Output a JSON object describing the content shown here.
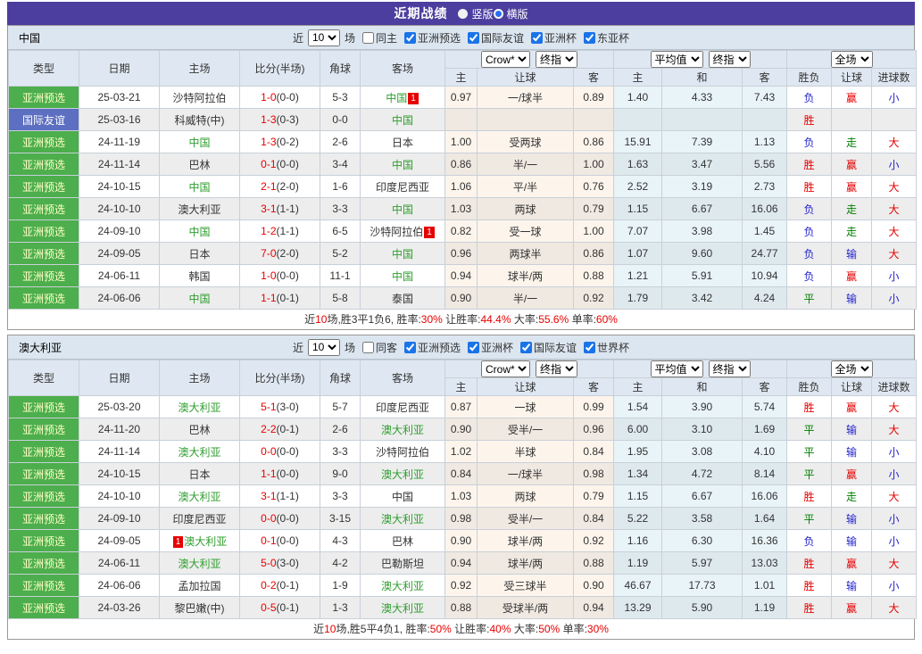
{
  "colors": {
    "titlebar_purple": "#4c3e9e",
    "section_bar_bg": "#dce6f0",
    "header_bg": "#dfe8f2",
    "type_green": "#4cae4c",
    "type_blue": "#5c6fc0",
    "focus_team_green": "#2f9e2f",
    "result_red": "#e60000",
    "result_blue": "#2424cc",
    "result_green": "#008000",
    "crow_col_bg": "#fdf5ec",
    "avg_col_bg": "#e9f4f9"
  },
  "titlebar": {
    "title": "近期战绩",
    "layout_options": [
      {
        "label": "竖版",
        "selected": false
      },
      {
        "label": "横版",
        "selected": true
      }
    ]
  },
  "columns": {
    "type": "类型",
    "date": "日期",
    "home": "主场",
    "score": "比分(半场)",
    "corner": "角球",
    "away": "客场",
    "odds_home": "主",
    "odds_handicap": "让球",
    "odds_away": "客",
    "avg_home": "主",
    "avg_draw": "和",
    "avg_away": "客",
    "result_wl": "胜负",
    "result_handicap": "让球",
    "result_goals": "进球数"
  },
  "dropdowns": {
    "odds_source": "Crow*",
    "odds_index": "终指",
    "avg_source": "平均值",
    "avg_index": "终指",
    "scope": "全场"
  },
  "sections": [
    {
      "team": "中国",
      "filter": {
        "prefix": "近",
        "count": "10",
        "suffix": "场",
        "same_side": "同主",
        "same_checked": false,
        "leagues": [
          "亚洲预选",
          "国际友谊",
          "亚洲杯",
          "东亚杯"
        ]
      },
      "rows": [
        {
          "type": "亚洲预选",
          "typeStyle": "green",
          "date": "25-03-21",
          "home": "沙特阿拉伯",
          "homeFocus": false,
          "score": "1-0",
          "half": "(0-0)",
          "corner": "5-3",
          "away": "中国",
          "awayFocus": true,
          "awayBadge": "1",
          "odds": [
            "0.97",
            "一/球半",
            "0.89"
          ],
          "avg": [
            "1.40",
            "4.33",
            "7.43"
          ],
          "results": [
            {
              "t": "负",
              "c": "blue"
            },
            {
              "t": "赢",
              "c": "red"
            },
            {
              "t": "小",
              "c": "blue"
            }
          ]
        },
        {
          "type": "国际友谊",
          "typeStyle": "blue",
          "date": "25-03-16",
          "home": "科威特(中)",
          "homeFocus": false,
          "score": "1-3",
          "half": "(0-3)",
          "corner": "0-0",
          "away": "中国",
          "awayFocus": true,
          "odds": [
            "",
            "",
            ""
          ],
          "avg": [
            "",
            "",
            ""
          ],
          "results": [
            {
              "t": "胜",
              "c": "red"
            },
            {
              "t": "",
              "c": ""
            },
            {
              "t": "",
              "c": ""
            }
          ]
        },
        {
          "type": "亚洲预选",
          "typeStyle": "green",
          "date": "24-11-19",
          "home": "中国",
          "homeFocus": true,
          "score": "1-3",
          "half": "(0-2)",
          "corner": "2-6",
          "away": "日本",
          "awayFocus": false,
          "odds": [
            "1.00",
            "受两球",
            "0.86"
          ],
          "avg": [
            "15.91",
            "7.39",
            "1.13"
          ],
          "results": [
            {
              "t": "负",
              "c": "blue"
            },
            {
              "t": "走",
              "c": "green"
            },
            {
              "t": "大",
              "c": "red"
            }
          ]
        },
        {
          "type": "亚洲预选",
          "typeStyle": "green",
          "date": "24-11-14",
          "home": "巴林",
          "homeFocus": false,
          "score": "0-1",
          "half": "(0-0)",
          "corner": "3-4",
          "away": "中国",
          "awayFocus": true,
          "odds": [
            "0.86",
            "半/一",
            "1.00"
          ],
          "avg": [
            "1.63",
            "3.47",
            "5.56"
          ],
          "results": [
            {
              "t": "胜",
              "c": "red"
            },
            {
              "t": "赢",
              "c": "red"
            },
            {
              "t": "小",
              "c": "blue"
            }
          ]
        },
        {
          "type": "亚洲预选",
          "typeStyle": "green",
          "date": "24-10-15",
          "home": "中国",
          "homeFocus": true,
          "score": "2-1",
          "half": "(2-0)",
          "corner": "1-6",
          "away": "印度尼西亚",
          "awayFocus": false,
          "odds": [
            "1.06",
            "平/半",
            "0.76"
          ],
          "avg": [
            "2.52",
            "3.19",
            "2.73"
          ],
          "results": [
            {
              "t": "胜",
              "c": "red"
            },
            {
              "t": "赢",
              "c": "red"
            },
            {
              "t": "大",
              "c": "red"
            }
          ]
        },
        {
          "type": "亚洲预选",
          "typeStyle": "green",
          "date": "24-10-10",
          "home": "澳大利亚",
          "homeFocus": false,
          "score": "3-1",
          "half": "(1-1)",
          "corner": "3-3",
          "away": "中国",
          "awayFocus": true,
          "odds": [
            "1.03",
            "两球",
            "0.79"
          ],
          "avg": [
            "1.15",
            "6.67",
            "16.06"
          ],
          "results": [
            {
              "t": "负",
              "c": "blue"
            },
            {
              "t": "走",
              "c": "green"
            },
            {
              "t": "大",
              "c": "red"
            }
          ]
        },
        {
          "type": "亚洲预选",
          "typeStyle": "green",
          "date": "24-09-10",
          "home": "中国",
          "homeFocus": true,
          "score": "1-2",
          "half": "(1-1)",
          "corner": "6-5",
          "away": "沙特阿拉伯",
          "awayFocus": false,
          "awayBadge": "1",
          "odds": [
            "0.82",
            "受一球",
            "1.00"
          ],
          "avg": [
            "7.07",
            "3.98",
            "1.45"
          ],
          "results": [
            {
              "t": "负",
              "c": "blue"
            },
            {
              "t": "走",
              "c": "green"
            },
            {
              "t": "大",
              "c": "red"
            }
          ]
        },
        {
          "type": "亚洲预选",
          "typeStyle": "green",
          "date": "24-09-05",
          "home": "日本",
          "homeFocus": false,
          "score": "7-0",
          "half": "(2-0)",
          "corner": "5-2",
          "away": "中国",
          "awayFocus": true,
          "odds": [
            "0.96",
            "两球半",
            "0.86"
          ],
          "avg": [
            "1.07",
            "9.60",
            "24.77"
          ],
          "results": [
            {
              "t": "负",
              "c": "blue"
            },
            {
              "t": "输",
              "c": "blue"
            },
            {
              "t": "大",
              "c": "red"
            }
          ]
        },
        {
          "type": "亚洲预选",
          "typeStyle": "green",
          "date": "24-06-11",
          "home": "韩国",
          "homeFocus": false,
          "score": "1-0",
          "half": "(0-0)",
          "corner": "11-1",
          "away": "中国",
          "awayFocus": true,
          "odds": [
            "0.94",
            "球半/两",
            "0.88"
          ],
          "avg": [
            "1.21",
            "5.91",
            "10.94"
          ],
          "results": [
            {
              "t": "负",
              "c": "blue"
            },
            {
              "t": "赢",
              "c": "red"
            },
            {
              "t": "小",
              "c": "blue"
            }
          ]
        },
        {
          "type": "亚洲预选",
          "typeStyle": "green",
          "date": "24-06-06",
          "home": "中国",
          "homeFocus": true,
          "score": "1-1",
          "half": "(0-1)",
          "corner": "5-8",
          "away": "泰国",
          "awayFocus": false,
          "odds": [
            "0.90",
            "半/一",
            "0.92"
          ],
          "avg": [
            "1.79",
            "3.42",
            "4.24"
          ],
          "results": [
            {
              "t": "平",
              "c": "green"
            },
            {
              "t": "输",
              "c": "blue"
            },
            {
              "t": "小",
              "c": "blue"
            }
          ]
        }
      ],
      "footer": [
        {
          "t": "近",
          "red": false
        },
        {
          "t": "10",
          "red": true
        },
        {
          "t": "场,胜3平1负6, 胜率:",
          "red": false
        },
        {
          "t": "30%",
          "red": true
        },
        {
          "t": " 让胜率:",
          "red": false
        },
        {
          "t": "44.4%",
          "red": true
        },
        {
          "t": " 大率:",
          "red": false
        },
        {
          "t": "55.6%",
          "red": true
        },
        {
          "t": " 单率:",
          "red": false
        },
        {
          "t": "60%",
          "red": true
        }
      ]
    },
    {
      "team": "澳大利亚",
      "filter": {
        "prefix": "近",
        "count": "10",
        "suffix": "场",
        "same_side": "同客",
        "same_checked": false,
        "leagues": [
          "亚洲预选",
          "亚洲杯",
          "国际友谊",
          "世界杯"
        ]
      },
      "rows": [
        {
          "type": "亚洲预选",
          "typeStyle": "green",
          "date": "25-03-20",
          "home": "澳大利亚",
          "homeFocus": true,
          "score": "5-1",
          "half": "(3-0)",
          "corner": "5-7",
          "away": "印度尼西亚",
          "awayFocus": false,
          "odds": [
            "0.87",
            "一球",
            "0.99"
          ],
          "avg": [
            "1.54",
            "3.90",
            "5.74"
          ],
          "results": [
            {
              "t": "胜",
              "c": "red"
            },
            {
              "t": "赢",
              "c": "red"
            },
            {
              "t": "大",
              "c": "red"
            }
          ]
        },
        {
          "type": "亚洲预选",
          "typeStyle": "green",
          "date": "24-11-20",
          "home": "巴林",
          "homeFocus": false,
          "score": "2-2",
          "half": "(0-1)",
          "corner": "2-6",
          "away": "澳大利亚",
          "awayFocus": true,
          "odds": [
            "0.90",
            "受半/一",
            "0.96"
          ],
          "avg": [
            "6.00",
            "3.10",
            "1.69"
          ],
          "results": [
            {
              "t": "平",
              "c": "green"
            },
            {
              "t": "输",
              "c": "blue"
            },
            {
              "t": "大",
              "c": "red"
            }
          ]
        },
        {
          "type": "亚洲预选",
          "typeStyle": "green",
          "date": "24-11-14",
          "home": "澳大利亚",
          "homeFocus": true,
          "score": "0-0",
          "half": "(0-0)",
          "corner": "3-3",
          "away": "沙特阿拉伯",
          "awayFocus": false,
          "odds": [
            "1.02",
            "半球",
            "0.84"
          ],
          "avg": [
            "1.95",
            "3.08",
            "4.10"
          ],
          "results": [
            {
              "t": "平",
              "c": "green"
            },
            {
              "t": "输",
              "c": "blue"
            },
            {
              "t": "小",
              "c": "blue"
            }
          ]
        },
        {
          "type": "亚洲预选",
          "typeStyle": "green",
          "date": "24-10-15",
          "home": "日本",
          "homeFocus": false,
          "score": "1-1",
          "half": "(0-0)",
          "corner": "9-0",
          "away": "澳大利亚",
          "awayFocus": true,
          "odds": [
            "0.84",
            "一/球半",
            "0.98"
          ],
          "avg": [
            "1.34",
            "4.72",
            "8.14"
          ],
          "results": [
            {
              "t": "平",
              "c": "green"
            },
            {
              "t": "赢",
              "c": "red"
            },
            {
              "t": "小",
              "c": "blue"
            }
          ]
        },
        {
          "type": "亚洲预选",
          "typeStyle": "green",
          "date": "24-10-10",
          "home": "澳大利亚",
          "homeFocus": true,
          "score": "3-1",
          "half": "(1-1)",
          "corner": "3-3",
          "away": "中国",
          "awayFocus": false,
          "odds": [
            "1.03",
            "两球",
            "0.79"
          ],
          "avg": [
            "1.15",
            "6.67",
            "16.06"
          ],
          "results": [
            {
              "t": "胜",
              "c": "red"
            },
            {
              "t": "走",
              "c": "green"
            },
            {
              "t": "大",
              "c": "red"
            }
          ]
        },
        {
          "type": "亚洲预选",
          "typeStyle": "green",
          "date": "24-09-10",
          "home": "印度尼西亚",
          "homeFocus": false,
          "score": "0-0",
          "half": "(0-0)",
          "corner": "3-15",
          "away": "澳大利亚",
          "awayFocus": true,
          "odds": [
            "0.98",
            "受半/一",
            "0.84"
          ],
          "avg": [
            "5.22",
            "3.58",
            "1.64"
          ],
          "results": [
            {
              "t": "平",
              "c": "green"
            },
            {
              "t": "输",
              "c": "blue"
            },
            {
              "t": "小",
              "c": "blue"
            }
          ]
        },
        {
          "type": "亚洲预选",
          "typeStyle": "green",
          "date": "24-09-05",
          "home": "澳大利亚",
          "homeFocus": true,
          "homeBadge": "1",
          "homeBadgePos": "before",
          "score": "0-1",
          "half": "(0-0)",
          "corner": "4-3",
          "away": "巴林",
          "awayFocus": false,
          "odds": [
            "0.90",
            "球半/两",
            "0.92"
          ],
          "avg": [
            "1.16",
            "6.30",
            "16.36"
          ],
          "results": [
            {
              "t": "负",
              "c": "blue"
            },
            {
              "t": "输",
              "c": "blue"
            },
            {
              "t": "小",
              "c": "blue"
            }
          ]
        },
        {
          "type": "亚洲预选",
          "typeStyle": "green",
          "date": "24-06-11",
          "home": "澳大利亚",
          "homeFocus": true,
          "score": "5-0",
          "half": "(3-0)",
          "corner": "4-2",
          "away": "巴勒斯坦",
          "awayFocus": false,
          "odds": [
            "0.94",
            "球半/两",
            "0.88"
          ],
          "avg": [
            "1.19",
            "5.97",
            "13.03"
          ],
          "results": [
            {
              "t": "胜",
              "c": "red"
            },
            {
              "t": "赢",
              "c": "red"
            },
            {
              "t": "大",
              "c": "red"
            }
          ]
        },
        {
          "type": "亚洲预选",
          "typeStyle": "green",
          "date": "24-06-06",
          "home": "孟加拉国",
          "homeFocus": false,
          "score": "0-2",
          "half": "(0-1)",
          "corner": "1-9",
          "away": "澳大利亚",
          "awayFocus": true,
          "odds": [
            "0.92",
            "受三球半",
            "0.90"
          ],
          "avg": [
            "46.67",
            "17.73",
            "1.01"
          ],
          "results": [
            {
              "t": "胜",
              "c": "red"
            },
            {
              "t": "输",
              "c": "blue"
            },
            {
              "t": "小",
              "c": "blue"
            }
          ]
        },
        {
          "type": "亚洲预选",
          "typeStyle": "green",
          "date": "24-03-26",
          "home": "黎巴嫩(中)",
          "homeFocus": false,
          "score": "0-5",
          "half": "(0-1)",
          "corner": "1-3",
          "away": "澳大利亚",
          "awayFocus": true,
          "odds": [
            "0.88",
            "受球半/两",
            "0.94"
          ],
          "avg": [
            "13.29",
            "5.90",
            "1.19"
          ],
          "results": [
            {
              "t": "胜",
              "c": "red"
            },
            {
              "t": "赢",
              "c": "red"
            },
            {
              "t": "大",
              "c": "red"
            }
          ]
        }
      ],
      "footer": [
        {
          "t": "近",
          "red": false
        },
        {
          "t": "10",
          "red": true
        },
        {
          "t": "场,胜5平4负1, 胜率:",
          "red": false
        },
        {
          "t": "50%",
          "red": true
        },
        {
          "t": " 让胜率:",
          "red": false
        },
        {
          "t": "40%",
          "red": true
        },
        {
          "t": " 大率:",
          "red": false
        },
        {
          "t": "50%",
          "red": true
        },
        {
          "t": " 单率:",
          "red": false
        },
        {
          "t": "30%",
          "red": true
        }
      ]
    }
  ]
}
